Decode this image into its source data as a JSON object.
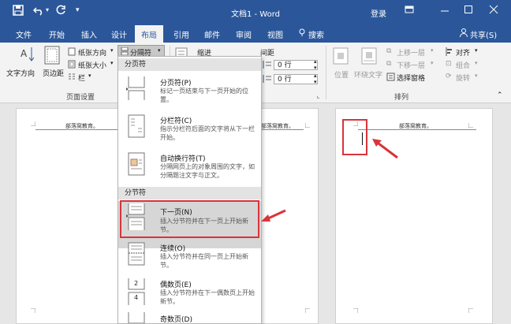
{
  "titlebar": {
    "save_icon": "save-icon",
    "undo_icon": "undo-icon",
    "redo_icon": "redo-icon",
    "customize_icon": "customize-quick-access-icon",
    "title": "文档1 - Word",
    "login": "登录",
    "ribbon_display_icon": "ribbon-display-options-icon",
    "minimize_icon": "minimize-icon",
    "maximize_icon": "maximize-icon",
    "close_icon": "close-icon"
  },
  "tabs": {
    "file": "文件",
    "home": "开始",
    "insert": "插入",
    "design": "设计",
    "layout": "布局",
    "references": "引用",
    "mailings": "邮件",
    "review": "审阅",
    "view": "视图",
    "search": "搜索",
    "share": "共享(S)"
  },
  "ribbon": {
    "text_direction": "文字方向",
    "margins": "页边距",
    "orientation": "纸张方向",
    "size": "纸张大小",
    "columns": "栏",
    "breaks": "分隔符",
    "page_setup_group": "页面设置",
    "indent": "缩进",
    "spacing": "间距",
    "spacing_before": "0 行",
    "spacing_after": "0 行",
    "position": "位置",
    "wrap_text": "环绕文字",
    "bring_forward": "上移一层",
    "send_backward": "下移一层",
    "selection_pane": "选择窗格",
    "align": "对齐",
    "group": "组合",
    "rotate": "旋转",
    "arrange_group": "排列"
  },
  "document": {
    "header_text_1": "部落窝教育。",
    "header_text_2": "部落窝教育。",
    "header_text_3": "部落窝教育。"
  },
  "menu": {
    "page_breaks_header": "分页符",
    "section_breaks_header": "分节符",
    "items": [
      {
        "title": "分页符(P)",
        "desc": "标记一页结束与下一页开始的位置。"
      },
      {
        "title": "分栏符(C)",
        "desc": "指示分栏符后面的文字将从下一栏开始。"
      },
      {
        "title": "自动换行符(T)",
        "desc": "分隔网页上的对象周围的文字，如分隔题注文字与正文。"
      },
      {
        "title": "下一页(N)",
        "desc": "插入分节符并在下一页上开始新节。"
      },
      {
        "title": "连续(O)",
        "desc": "插入分节符并在同一页上开始新节。"
      },
      {
        "title": "偶数页(E)",
        "desc": "插入分节符并在下一偶数页上开始新节。"
      },
      {
        "title": "奇数页(D)",
        "desc": ""
      }
    ],
    "even_icon_label_1": "2",
    "even_icon_label_2": "4"
  },
  "colors": {
    "word_blue": "#2b579a",
    "annotation_red": "#d9343a",
    "highlight": "#d6d6d6"
  }
}
